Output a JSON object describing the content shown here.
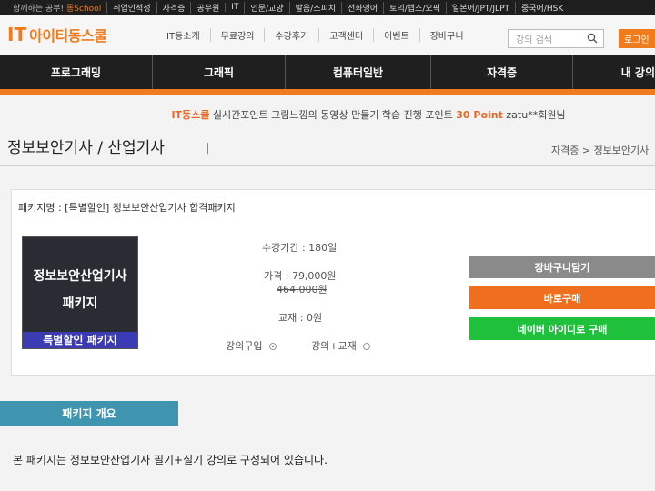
{
  "topbar": {
    "promo_text": "함께하는 공부!",
    "promo_brand": "동School",
    "links": [
      "취업인적성",
      "자격증",
      "공무원",
      "IT",
      "인문/교양",
      "발음/스피치",
      "전화영어",
      "토익/텝스/오픽",
      "일본어/JPT/JLPT",
      "중국어/HSK"
    ]
  },
  "header": {
    "logo_mark": "IT",
    "logo_text": "아이티동스쿨",
    "nav": [
      "IT동소개",
      "무료강의",
      "수강후기",
      "고객센터",
      "이벤트",
      "장바구니"
    ],
    "search_placeholder": "강의 검색",
    "login_label": "로그인"
  },
  "categories": [
    "프로그래밍",
    "그래픽",
    "컴퓨터일반",
    "자격증",
    "내 강의"
  ],
  "point_banner": {
    "brand": "IT동스쿨",
    "text": "실시간포인트 그림느낌의 동영상 만들기 학습 진행 포인트",
    "points": "30 Point",
    "user": "zatu**회원님"
  },
  "page": {
    "title": "정보보안기사 / 산업기사",
    "breadcrumb": "자격증 > 정보보안기사"
  },
  "package": {
    "name_line": "패키지명 : [특별할인] 정보보안산업기사 합격패키지",
    "thumb_line1": "정보보안산업기사",
    "thumb_line2": "패키지",
    "thumb_band": "특별할인 패키지",
    "period": "수강기간 : 180일",
    "price": "가격 : 79,000원",
    "original_price": "464,000원",
    "textbook": "교재 : 0원",
    "option_lecture": "강의구입",
    "option_lecture_book": "강의+교재"
  },
  "buttons": {
    "cart": "장바구니담기",
    "buy": "바로구매",
    "naver": "네이버 아이디로 구매"
  },
  "tabs": {
    "overview": "패키지 개요"
  },
  "description": "본 패키지는 정보보안산업기사 필기+실기 강의로 구성되어 있습니다.",
  "colors": {
    "accent": "#f07c1d",
    "tab": "#3f95b0",
    "naver": "#1fc13c"
  }
}
